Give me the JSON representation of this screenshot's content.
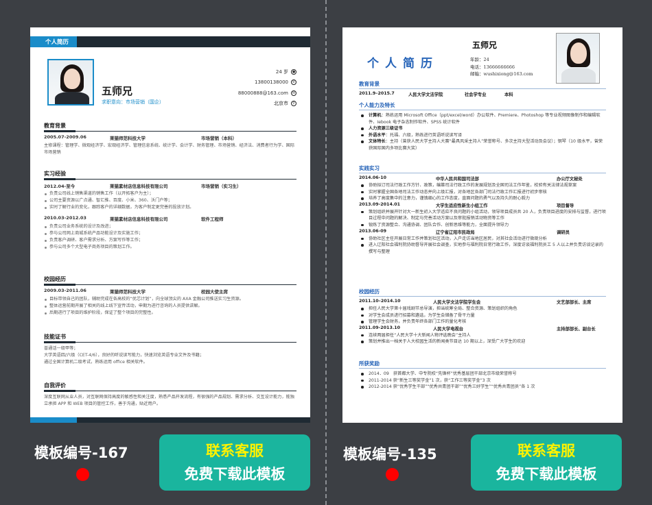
{
  "resume1": {
    "header_label": "个人简历",
    "name": "五师兄",
    "intent": "求职意向：市场营销（国企）",
    "contact": [
      "24 岁",
      "13800138000",
      "88000888@163.com",
      "北京市"
    ],
    "contact_icons": [
      "user-icon",
      "phone-icon",
      "mail-icon",
      "location-icon"
    ],
    "education": {
      "title": "教育背景",
      "row": [
        "2005.07-2009.06",
        "莱猫师范科技大学",
        "市场营销（本科）"
      ],
      "text": "主修课程：管理学、微观经济学、宏观经济学、管理信息系统、统计学、会计学、财务管理、市场营销、经济法、消费者行为学、国际市场营销"
    },
    "internship": {
      "title": "实习经验",
      "jobs": [
        {
          "row": [
            "2012.04-至今",
            "莱猫素材店信息科技有限公司",
            "市场营销（实习生）"
          ],
          "items": [
            "负责公司线上销售渠道的销售工作（以开拓客户为主）；",
            "公司主要资源以广点通、智汇推、百度、小米、360、沃门户等；",
            "实时了解行业的变化，跟踪客户的详细数据，为客户制定更完善的投放计划。"
          ]
        },
        {
          "row": [
            "2010.03-2012.03",
            "莱猫素材店信息科技有限公司",
            "软件工程师"
          ],
          "items": [
            "负责公司业务系统的设计及改进；",
            "参与公司网上商城系统产品功能设计及实施工作；",
            "负责客户调研、客户需求分析、方案写作等工作；",
            "参与公司多个大型电子商务项目的策划工作。"
          ]
        }
      ]
    },
    "campus": {
      "title": "校园经历",
      "row": [
        "2009.03-2011.06",
        "莱猫师范科技大学",
        "校园大使主席"
      ],
      "items": [
        "目标带领自己的团队，辅助完成在各高校的“优芯计划”，向全球顶尖的 AXA 金融公司推送实习生资源。",
        "整体运营前期开展了相关的线上线下宣传活动，申期为进行咨询的人员提供讲解。",
        "后期进行了项目的维护阶段，保证了整个项目的完整性。"
      ]
    },
    "skills": {
      "title": "技能证书",
      "lines": [
        "普通话一级甲等；",
        "大学英语四/六级（CET-4/6），良好的听说读写能力，快速浏览英语专业文件及书籍；",
        "通过全国计算机二级考试，熟练运用 office 相关软件。"
      ]
    },
    "evaluation": {
      "title": "自我评价",
      "text": "深度互联网从业人员，对互联网保持高度的敏感性和关注度，熟悉产品开发流程，有很强的产品规划、需求分析、交互设计能力，能独立承担 APP 和 WEB 项目的管控工作，善于沟通，贴近用户。"
    }
  },
  "resume2": {
    "title": "个人简历",
    "name": "五师兄",
    "info": [
      "年龄：24",
      "电话：13666666666",
      "邮箱：wushixiong@163.com"
    ],
    "education": {
      "title": "教育背景",
      "row": [
        "2011.9–2015.7",
        "人民大学文法学院",
        "社会学专业",
        "本科"
      ]
    },
    "abilities": {
      "title": "个人能力及特长",
      "items": [
        {
          "k": "计算机",
          "v": "：熟练运用 Microsoft Office（ppt/excel/word）办公软件、Premiere、Photoshop 等专业视频图像制作和编辑软件、Iebook 电子杂志制作软件、SPSS 统计软件"
        },
        {
          "k": "人力资源三级证书",
          "v": ""
        },
        {
          "k": "外语水平",
          "v": "：托福、六级，熟练进行英语听说读写译"
        },
        {
          "k": "文体特长",
          "v": "：主持（曾获人民大学主持人大赛“最具风采主持人”荣誉称号、多次主持大型活动及会议）；钢琴（10 级水平，曾荣获国际国内多项比赛大奖）"
        }
      ]
    },
    "practice": {
      "title": "实践实习",
      "jobs": [
        {
          "row": [
            "2014.06-10",
            "中华人民共和国司法部",
            "办公厅文秘处"
          ],
          "items": [
            "协助拟订司法行政工作方针、政策，编篡司法行政工作的发展规划及全国司法工作年鉴，校验有关法律法规草案",
            "实时掌握全国各地司法工作动态并向上级汇报，对各地区各部门司法行政工作汇报进行初步审核",
            "培养了高度集中的注意力，谨慎细心的工作态度，直面问题的勇气以及持久的耐心毅力"
          ]
        },
        {
          "row": [
            "2013.09-2014.01",
            "大学生适应性新生小组工作",
            "项目督导"
          ],
          "items": [
            "策划组织并展开针对大一新生初入大学适应不良问题的小组活动，领导项目成员共 20 人，负责项目进度的安排与监督，进行项目过程中问题的解决、制定与完善活动方案以及审批报销活动物资等工作",
            "锻炼了资源整合、沟通协调、团队合作、创新思维等能力，全面提升领导力"
          ]
        },
        {
          "row": [
            "2013.06-09",
            "辽宁省辽阳市民政局",
            "调研员"
          ],
          "items": [
            "协助社区主任开展日常工作并策划社区活动，入户走访当地区居民，对其社会活动进行微观分析",
            "进入辽阳社会福利院协助督导开展社会调查，实地参与福利院日常行政工作，深度访谈福利院员工 5 人以上并负责访谈记录的撰写与整理"
          ]
        }
      ]
    },
    "campus": {
      "title": "校园经历",
      "jobs": [
        {
          "row": [
            "2011.10–2014.10",
            "人民大学文法学院学生会",
            "文艺部部长、主席"
          ],
          "items": [
            "担任人民大学第十届戏剧节总导演，担当统筹全局、整合资源、策划组织的角色",
            "对学生会成员进行招募和遴选，为学生会储备了骨干力量",
            "管理学生会财务，并负责年终各部门工作的量化考核"
          ]
        },
        {
          "row": [
            "2011.09-2013.10",
            "人民大学电视台",
            "主持部部长、副台长"
          ],
          "items": [
            "连续两届担任“人民大学十大新闻人物评选晚会”主持人",
            "策划并推出一档关于人大校园生活的新闻类节目达 10 期以上，深受广大学生的欢迎"
          ]
        }
      ]
    },
    "awards": {
      "title": "所获奖励",
      "items": [
        "2014．09　获首都大学、中专院校“先锋杯”优秀基层团干部北京市级荣誉称号",
        "2011-2014 获“新生三等奖学金”1 次，获“工作三等奖学金”3 次",
        "2012-2014 获“优秀学生干部”“优秀共青团干部”“优秀三好学生”“优秀共青团员”各 1 次"
      ]
    }
  },
  "labels": {
    "template1": "模板编号-167",
    "template2": "模板编号-135",
    "cta_line1": "联系客服",
    "cta_line2": "免费下载此模板"
  },
  "colors": {
    "background": "#3c3f44",
    "accent_blue": "#1a8cc9",
    "cta_green": "#1ab59e",
    "cta_yellow": "#fff200",
    "dot_red": "#ff0000"
  }
}
